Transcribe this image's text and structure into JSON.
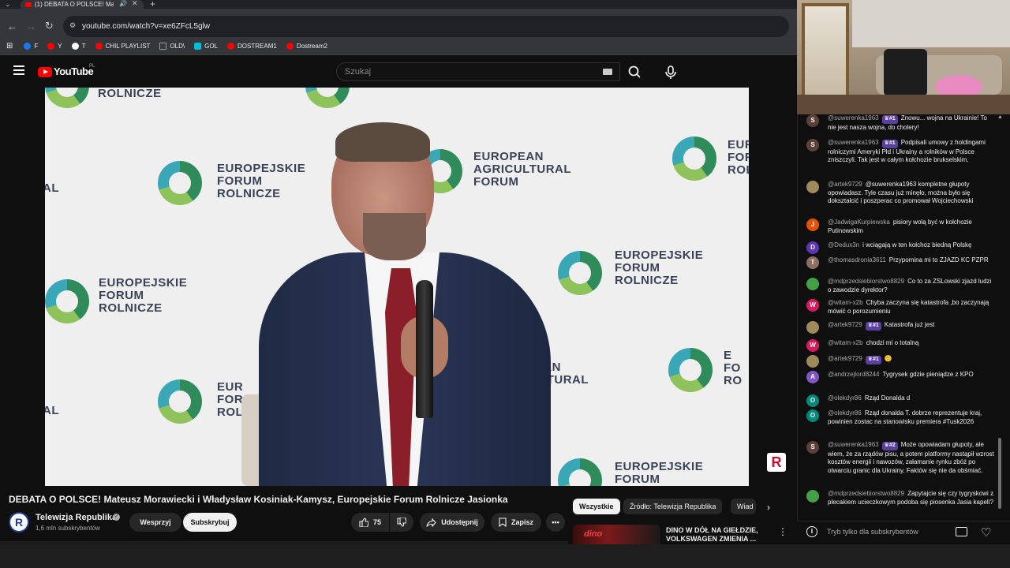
{
  "browser": {
    "tab_title": "(1) DEBATA O POLSCE! Mat",
    "url": "youtube.com/watch?v=xe6ZFcL5glw",
    "bookmarks": [
      {
        "label": "F",
        "color": "#1877f2"
      },
      {
        "label": "Y",
        "color": "#ff0000"
      },
      {
        "label": "T",
        "color": "#ffffff"
      },
      {
        "label": "CHIL PLAYLIST",
        "color": "#ff0000"
      },
      {
        "label": "OLD\\",
        "color": "#9aa0a6"
      },
      {
        "label": "GOL",
        "color": "#00bcd4"
      },
      {
        "label": "DOSTREAM1",
        "color": "#ff0000"
      },
      {
        "label": "Dostream2",
        "color": "#ff0000"
      }
    ]
  },
  "youtube": {
    "logo": "YouTube",
    "logo_country": "PL",
    "search_placeholder": "Szukaj"
  },
  "video": {
    "backdrop_text": {
      "ef_line1": "EUROPEJSKIE",
      "ef_line2": "FORUM",
      "ef_line3": "ROLNICZE",
      "eaf_line1": "EUROPEAN",
      "eaf_line2": "AGRICULTURAL",
      "eaf_line3": "FORUM",
      "top_partial": "ROLNICZE",
      "cut_eur": "EUR",
      "cut_for": "FOR",
      "cut_rol": "ROL",
      "cut_e": "E",
      "cut_fo": "FO",
      "cut_ro": "RO",
      "cut_ul": "UL",
      "cut_al": "AL",
      "cut_forum": "FORUM"
    },
    "badge": "R",
    "title": "DEBATA O POLSCE! Mateusz Morawiecki i Władysław Kosiniak-Kamysz, Europejskie Forum Rolnicze Jasionka"
  },
  "channel": {
    "avatar_letter": "R",
    "name": "Telewizja Republika",
    "subscribers": "1,6 mln subskrybentów",
    "join_label": "Wesprzyj",
    "subscribe_label": "Subskrybuj"
  },
  "actions": {
    "likes": "75",
    "share_label": "Udostępnij",
    "save_label": "Zapisz"
  },
  "chips": [
    "Wszystkie",
    "Źródło: Telewizja Republika",
    "Wiad"
  ],
  "recommended": {
    "thumb_text": "dino",
    "title": "DINO W DÓŁ NA GIEŁDZIE, VOLKSWAGEN ZMIENIA ..."
  },
  "chat": {
    "messages": [
      {
        "avatar": "S",
        "color": "#5d4037",
        "author": "@suwerenka1963",
        "badge": "#1",
        "text": "Znowu... wojna na Ukrainie! To nie jest nasza wojna, do cholery!"
      },
      {
        "avatar": "S",
        "color": "#5d4037",
        "author": "@suwerenka1963",
        "badge": "#1",
        "text": "Podpisali umowy z holdingami rolniczymi Ameryki Płd i Ukrainy a rolników w Polsce zniszczyli. Tak jest w całym kołchozie brukselskim."
      },
      {
        "avatar": "",
        "color": "#9e8a5a",
        "author": "@artek9729",
        "badge": "",
        "text": "@suwerenka1963 kompletne głupoty opowiadasz. Tyle czasu już minęło, można było się dokształcić i poszperac co promował Wojciechowski"
      },
      {
        "avatar": "J",
        "color": "#e65100",
        "author": "@JadwigaKurpiewska",
        "badge": "",
        "text": "pisiory wolą być w kołchozie Putinowskim"
      },
      {
        "avatar": "D",
        "color": "#5e35b1",
        "author": "@Deduх3n",
        "badge": "",
        "text": "i wciągają w ten kołchoz biedną Polskę"
      },
      {
        "avatar": "T",
        "color": "#8d6e63",
        "author": "@thomasdronia3611",
        "badge": "",
        "text": "Przypomina mi to ZJAZD KC PZPR"
      },
      {
        "avatar": "",
        "color": "#43a047",
        "author": "@mdprzedsiebiorstwo8829",
        "badge": "",
        "text": "Co to za ZSLowski zjazd ludzi o zawodzie dyrektor?"
      },
      {
        "avatar": "W",
        "color": "#d81b60",
        "author": "@witam-x2b",
        "badge": "",
        "text": "Chyba zaczyna się katastrofa ,bo zaczynają mówić o porozumieniu"
      },
      {
        "avatar": "",
        "color": "#9e8a5a",
        "author": "@artek9729",
        "badge": "#1",
        "text": "Katastrofa już jest"
      },
      {
        "avatar": "W",
        "color": "#d81b60",
        "author": "@witam-x2b",
        "badge": "",
        "text": "chodzi mi o totalną"
      },
      {
        "avatar": "",
        "color": "#9e8a5a",
        "author": "@artek9729",
        "badge": "#1",
        "text": "🙂"
      },
      {
        "avatar": "A",
        "color": "#7e57c2",
        "author": "@andrzejlord8244",
        "badge": "",
        "text": "Tygrysek gdzie pieniądze z KPO"
      },
      {
        "avatar": "O",
        "color": "#00897b",
        "author": "@olekdyr86",
        "badge": "",
        "text": "Rząd Donalda d"
      },
      {
        "avatar": "O",
        "color": "#00897b",
        "author": "@olekdyr86",
        "badge": "",
        "text": "Rząd donalda T. dobrze reprezentuje kraj, powinien zostac na stanowisku premiera #Tusk2026"
      },
      {
        "avatar": "S",
        "color": "#5d4037",
        "author": "@suwerenka1963",
        "badge": "#2",
        "text": "Może opowiadam głupoty, ale wiem, że za rządów pisu, a potem platformy nastąpił wzrost kosztów energii i nawozów, załamanie rynku zbóż po otwarciu granic dla Ukrainy. Faktów się nie da obśmiać."
      },
      {
        "avatar": "",
        "color": "#43a047",
        "author": "@mdprzedsiebiorstwo8829",
        "badge": "",
        "text": "Zapytajcie się czy tygryskowi z plecakiem ucieczkowym podoba się piosenka Jasia kapeli?"
      }
    ],
    "footer_text": "Tryb tylko dla subskrybentów"
  }
}
